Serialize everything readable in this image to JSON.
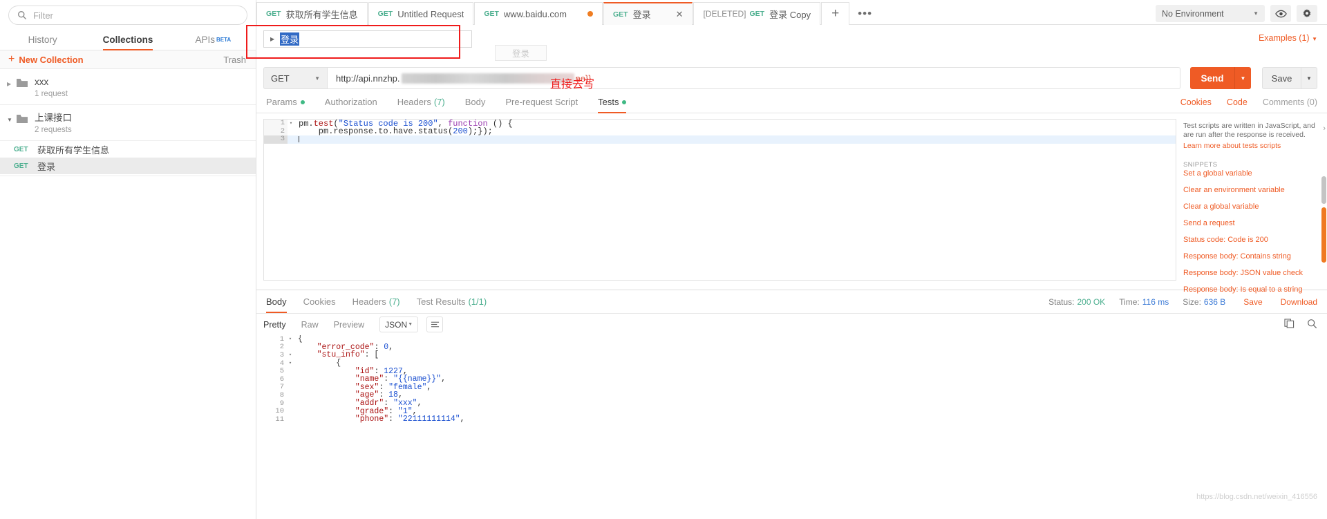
{
  "sidebar": {
    "filter_placeholder": "Filter",
    "filter_value": "",
    "tabs": [
      {
        "label": "History",
        "active": false
      },
      {
        "label": "Collections",
        "active": true
      },
      {
        "label": "APIs",
        "badge": "BETA",
        "active": false
      }
    ],
    "new_collection_label": "New Collection",
    "trash_label": "Trash",
    "collections": [
      {
        "name": "xxx",
        "count": "1 request",
        "expanded": false,
        "requests": []
      },
      {
        "name": "上课接口",
        "count": "2 requests",
        "expanded": true,
        "requests": [
          {
            "method": "GET",
            "name": "获取所有学生信息",
            "selected": false
          },
          {
            "method": "GET",
            "name": "登录",
            "selected": true
          }
        ]
      }
    ]
  },
  "topbar": {
    "request_tabs": [
      {
        "method": "GET",
        "title": "获取所有学生信息",
        "active": false,
        "dirty": false,
        "deleted": ""
      },
      {
        "method": "GET",
        "title": "Untitled Request",
        "active": false,
        "dirty": false,
        "deleted": ""
      },
      {
        "method": "GET",
        "title": "www.baidu.com",
        "active": false,
        "dirty": true,
        "deleted": ""
      },
      {
        "method": "GET",
        "title": "登录",
        "active": true,
        "dirty": false,
        "deleted": ""
      },
      {
        "method": "GET",
        "title": "登录 Copy",
        "active": false,
        "dirty": false,
        "deleted": "[DELETED]"
      }
    ],
    "add_tab_label": "+",
    "more_label": "•••",
    "environment": "No Environment",
    "eye_icon": "eye-icon",
    "gear_icon": "gear-icon"
  },
  "request": {
    "name_value": "登录",
    "name_ghost": "登录",
    "examples_label": "Examples (1)",
    "method": "GET",
    "url_prefix": "http://api.nnzhp.",
    "url_suffix": "ne}}",
    "send_label": "Send",
    "save_label": "Save",
    "annotation": "直接去写",
    "tabs": [
      {
        "label": "Params",
        "dot": true,
        "count": "",
        "active": false
      },
      {
        "label": "Authorization",
        "dot": false,
        "count": "",
        "active": false
      },
      {
        "label": "Headers",
        "dot": false,
        "count": "(7)",
        "active": false
      },
      {
        "label": "Body",
        "dot": false,
        "count": "",
        "active": false
      },
      {
        "label": "Pre-request Script",
        "dot": false,
        "count": "",
        "active": false
      },
      {
        "label": "Tests",
        "dot": true,
        "count": "",
        "active": true
      }
    ],
    "right_links": [
      {
        "label": "Cookies",
        "muted": false
      },
      {
        "label": "Code",
        "muted": false
      },
      {
        "label": "Comments (0)",
        "muted": true
      }
    ]
  },
  "code_editor": {
    "lines": [
      {
        "n": "1",
        "fold": "▾",
        "segments": [
          {
            "t": "pm.",
            "c": ""
          },
          {
            "t": "test",
            "c": "k-fn"
          },
          {
            "t": "(",
            "c": ""
          },
          {
            "t": "\"Status code is 200\"",
            "c": "k-str"
          },
          {
            "t": ", ",
            "c": ""
          },
          {
            "t": "function",
            "c": "k-kw"
          },
          {
            "t": " () {",
            "c": ""
          }
        ]
      },
      {
        "n": "2",
        "fold": "",
        "segments": [
          {
            "t": "    pm.response.to.have.status(",
            "c": ""
          },
          {
            "t": "200",
            "c": "k-num"
          },
          {
            "t": ");});",
            "c": ""
          }
        ]
      },
      {
        "n": "3",
        "fold": "",
        "segments": [],
        "highlight": true
      }
    ]
  },
  "snippets": {
    "intro": "Test scripts are written in JavaScript, and are run after the response is received.",
    "learn_more": "Learn more about tests scripts",
    "section_title": "SNIPPETS",
    "items": [
      "Set a global variable",
      "Clear an environment variable",
      "Clear a global variable",
      "Send a request",
      "Status code: Code is 200",
      "Response body: Contains string",
      "Response body: JSON value check",
      "Response body: Is equal to a string"
    ]
  },
  "response": {
    "tabs": [
      {
        "label": "Body",
        "count": "",
        "active": true
      },
      {
        "label": "Cookies",
        "count": "",
        "active": false
      },
      {
        "label": "Headers",
        "count": "(7)",
        "active": false
      },
      {
        "label": "Test Results",
        "count": "(1/1)",
        "active": false
      }
    ],
    "status_label": "Status:",
    "status_value": "200 OK",
    "time_label": "Time:",
    "time_value": "116 ms",
    "size_label": "Size:",
    "size_value": "636 B",
    "save_label": "Save",
    "download_label": "Download",
    "view_modes": [
      {
        "label": "Pretty",
        "active": true
      },
      {
        "label": "Raw",
        "active": false
      },
      {
        "label": "Preview",
        "active": false
      }
    ],
    "format": "JSON",
    "wrap_icon": "wrap-lines-icon",
    "copy_icon": "copy-icon",
    "search_icon": "search-icon",
    "body_lines": [
      {
        "n": "1",
        "fold": "▾",
        "segments": [
          {
            "t": "{",
            "c": "j-br"
          }
        ]
      },
      {
        "n": "2",
        "fold": "",
        "segments": [
          {
            "t": "    ",
            "c": ""
          },
          {
            "t": "\"error_code\"",
            "c": "j-key"
          },
          {
            "t": ": ",
            "c": ""
          },
          {
            "t": "0",
            "c": "j-num"
          },
          {
            "t": ",",
            "c": ""
          }
        ]
      },
      {
        "n": "3",
        "fold": "▾",
        "segments": [
          {
            "t": "    ",
            "c": ""
          },
          {
            "t": "\"stu_info\"",
            "c": "j-key"
          },
          {
            "t": ": [",
            "c": ""
          }
        ]
      },
      {
        "n": "4",
        "fold": "▾",
        "segments": [
          {
            "t": "        {",
            "c": "j-br"
          }
        ]
      },
      {
        "n": "5",
        "fold": "",
        "segments": [
          {
            "t": "            ",
            "c": ""
          },
          {
            "t": "\"id\"",
            "c": "j-key"
          },
          {
            "t": ": ",
            "c": ""
          },
          {
            "t": "1227",
            "c": "j-num"
          },
          {
            "t": ",",
            "c": ""
          }
        ]
      },
      {
        "n": "6",
        "fold": "",
        "segments": [
          {
            "t": "            ",
            "c": ""
          },
          {
            "t": "\"name\"",
            "c": "j-key"
          },
          {
            "t": ": ",
            "c": ""
          },
          {
            "t": "\"{{name}}\"",
            "c": "j-str"
          },
          {
            "t": ",",
            "c": ""
          }
        ]
      },
      {
        "n": "7",
        "fold": "",
        "segments": [
          {
            "t": "            ",
            "c": ""
          },
          {
            "t": "\"sex\"",
            "c": "j-key"
          },
          {
            "t": ": ",
            "c": ""
          },
          {
            "t": "\"female\"",
            "c": "j-str"
          },
          {
            "t": ",",
            "c": ""
          }
        ]
      },
      {
        "n": "8",
        "fold": "",
        "segments": [
          {
            "t": "            ",
            "c": ""
          },
          {
            "t": "\"age\"",
            "c": "j-key"
          },
          {
            "t": ": ",
            "c": ""
          },
          {
            "t": "18",
            "c": "j-num"
          },
          {
            "t": ",",
            "c": ""
          }
        ]
      },
      {
        "n": "9",
        "fold": "",
        "segments": [
          {
            "t": "            ",
            "c": ""
          },
          {
            "t": "\"addr\"",
            "c": "j-key"
          },
          {
            "t": ": ",
            "c": ""
          },
          {
            "t": "\"xxx\"",
            "c": "j-str"
          },
          {
            "t": ",",
            "c": ""
          }
        ]
      },
      {
        "n": "10",
        "fold": "",
        "segments": [
          {
            "t": "            ",
            "c": ""
          },
          {
            "t": "\"grade\"",
            "c": "j-key"
          },
          {
            "t": ": ",
            "c": ""
          },
          {
            "t": "\"1\"",
            "c": "j-str"
          },
          {
            "t": ",",
            "c": ""
          }
        ]
      },
      {
        "n": "11",
        "fold": "",
        "segments": [
          {
            "t": "            ",
            "c": ""
          },
          {
            "t": "\"phone\"",
            "c": "j-key"
          },
          {
            "t": ": ",
            "c": ""
          },
          {
            "t": "\"22111111114\"",
            "c": "j-str"
          },
          {
            "t": ",",
            "c": ""
          }
        ]
      }
    ]
  },
  "watermark": "https://blog.csdn.net/weixin_416556"
}
